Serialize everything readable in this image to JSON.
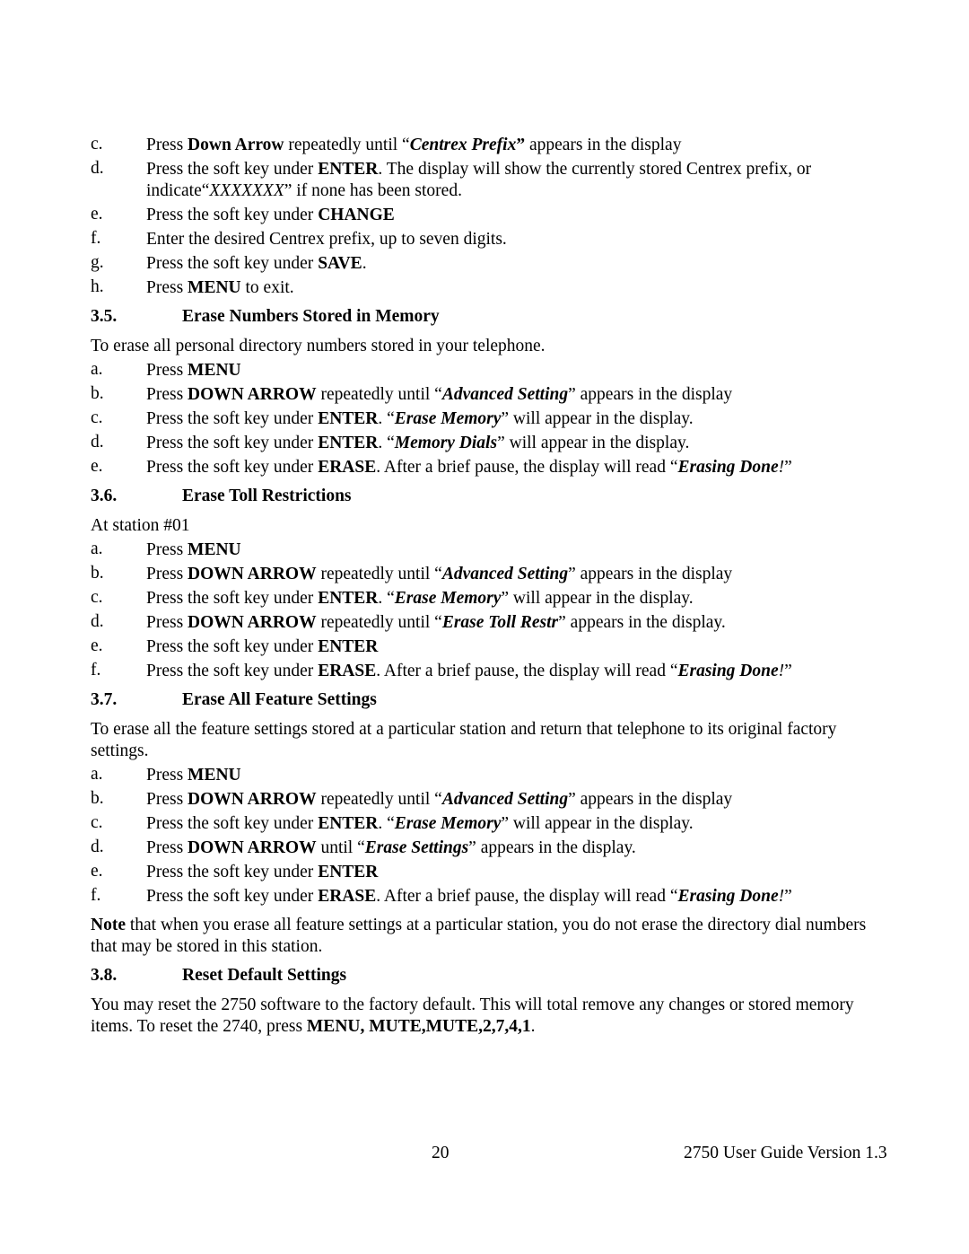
{
  "document": {
    "intro_steps": [
      {
        "letter": "c.",
        "runs": [
          [
            "",
            "Press "
          ],
          [
            "b",
            "Down Arrow"
          ],
          [
            "",
            " repeatedly until “"
          ],
          [
            "bi",
            "Centrex Prefix"
          ],
          [
            "b",
            "”"
          ],
          [
            "",
            " appears in the display"
          ]
        ]
      },
      {
        "letter": "d.",
        "runs": [
          [
            "",
            "Press the soft key under "
          ],
          [
            "b",
            "ENTER"
          ],
          [
            "",
            ". The display will show the currently stored Centrex prefix, or indicate“"
          ],
          [
            "i",
            "XXXXXXX"
          ],
          [
            "",
            "” if none has been stored."
          ]
        ]
      },
      {
        "letter": "e.",
        "runs": [
          [
            "",
            "Press the soft key under "
          ],
          [
            "b",
            "CHANGE"
          ]
        ]
      },
      {
        "letter": "f.",
        "runs": [
          [
            "",
            "Enter the desired Centrex prefix, up to seven digits."
          ]
        ]
      },
      {
        "letter": "g.",
        "runs": [
          [
            "",
            "Press the soft key under "
          ],
          [
            "b",
            "SAVE"
          ],
          [
            "",
            "."
          ]
        ]
      },
      {
        "letter": "h.",
        "runs": [
          [
            "",
            "Press "
          ],
          [
            "b",
            "MENU"
          ],
          [
            "",
            " to exit."
          ]
        ]
      }
    ],
    "sections": [
      {
        "number": "3.5.",
        "title": "Erase Numbers Stored in Memory",
        "intro": [
          [
            "",
            "To erase all personal directory numbers stored in your telephone."
          ]
        ],
        "steps": [
          {
            "letter": "a.",
            "runs": [
              [
                "",
                "Press "
              ],
              [
                "b",
                "MENU"
              ]
            ]
          },
          {
            "letter": "b.",
            "runs": [
              [
                "",
                "Press "
              ],
              [
                "b",
                "DOWN ARROW"
              ],
              [
                "",
                " repeatedly until “"
              ],
              [
                "bi",
                "Advanced Setting"
              ],
              [
                "",
                "” appears in the display"
              ]
            ]
          },
          {
            "letter": "c.",
            "runs": [
              [
                "",
                "Press the soft key under "
              ],
              [
                "b",
                "ENTER"
              ],
              [
                "",
                ". “"
              ],
              [
                "bi",
                "Erase Memory"
              ],
              [
                "",
                "” will appear in the display."
              ]
            ]
          },
          {
            "letter": "d.",
            "runs": [
              [
                "",
                "Press the soft key under "
              ],
              [
                "b",
                "ENTER"
              ],
              [
                "",
                ". “"
              ],
              [
                "bi",
                "Memory Dials"
              ],
              [
                "",
                "” will appear in the display."
              ]
            ]
          },
          {
            "letter": "e.",
            "runs": [
              [
                "",
                "Press the soft key under "
              ],
              [
                "b",
                "ERASE"
              ],
              [
                "",
                ". After a brief pause, the display will read “"
              ],
              [
                "bi",
                "Erasing Done"
              ],
              [
                "i",
                "!"
              ],
              [
                "",
                "”"
              ]
            ]
          }
        ]
      },
      {
        "number": "3.6.",
        "title": "Erase Toll Restrictions",
        "intro": [
          [
            "",
            "At station #01"
          ]
        ],
        "steps": [
          {
            "letter": "a.",
            "runs": [
              [
                "",
                "Press "
              ],
              [
                "b",
                "MENU"
              ]
            ]
          },
          {
            "letter": "b.",
            "runs": [
              [
                "",
                "Press "
              ],
              [
                "b",
                "DOWN ARROW"
              ],
              [
                "",
                " repeatedly until “"
              ],
              [
                "bi",
                "Advanced Setting"
              ],
              [
                "",
                "” appears in the display"
              ]
            ]
          },
          {
            "letter": "c.",
            "runs": [
              [
                "",
                "Press the soft key under "
              ],
              [
                "b",
                "ENTER"
              ],
              [
                "",
                ". “"
              ],
              [
                "bi",
                "Erase Memory"
              ],
              [
                "",
                "” will appear in the display."
              ]
            ]
          },
          {
            "letter": "d.",
            "runs": [
              [
                "",
                "Press "
              ],
              [
                "b",
                "DOWN ARROW"
              ],
              [
                "",
                " repeatedly until “"
              ],
              [
                "bi",
                "Erase Toll Restr"
              ],
              [
                "",
                "” appears in the display."
              ]
            ]
          },
          {
            "letter": "e.",
            "runs": [
              [
                "",
                "Press the soft key under "
              ],
              [
                "b",
                "ENTER"
              ]
            ]
          },
          {
            "letter": "f.",
            "runs": [
              [
                "",
                "Press the soft key under "
              ],
              [
                "b",
                "ERASE"
              ],
              [
                "",
                ". After a brief pause, the display will read “"
              ],
              [
                "bi",
                "Erasing Done"
              ],
              [
                "i",
                "!"
              ],
              [
                "",
                "”"
              ]
            ]
          }
        ]
      },
      {
        "number": "3.7.",
        "title": "Erase All Feature Settings",
        "intro": [
          [
            "",
            "To erase all the feature settings stored at a particular station and return that telephone to its original factory settings."
          ]
        ],
        "steps": [
          {
            "letter": "a.",
            "runs": [
              [
                "",
                "Press "
              ],
              [
                "b",
                "MENU"
              ]
            ]
          },
          {
            "letter": "b.",
            "runs": [
              [
                "",
                "Press "
              ],
              [
                "b",
                "DOWN ARROW"
              ],
              [
                "",
                " repeatedly until “"
              ],
              [
                "bi",
                "Advanced Setting"
              ],
              [
                "",
                "” appears in the display"
              ]
            ]
          },
          {
            "letter": "c.",
            "runs": [
              [
                "",
                "Press the soft key under "
              ],
              [
                "b",
                "ENTER"
              ],
              [
                "",
                ". “"
              ],
              [
                "bi",
                "Erase Memory"
              ],
              [
                "",
                "” will appear in the display."
              ]
            ]
          },
          {
            "letter": "d.",
            "runs": [
              [
                "",
                "Press "
              ],
              [
                "b",
                "DOWN ARROW"
              ],
              [
                "",
                " until “"
              ],
              [
                "bi",
                "Erase Settings"
              ],
              [
                "",
                "” appears in the display."
              ]
            ]
          },
          {
            "letter": "e.",
            "runs": [
              [
                "",
                "Press the soft key under "
              ],
              [
                "b",
                "ENTER"
              ]
            ]
          },
          {
            "letter": "f.",
            "runs": [
              [
                "",
                "Press the soft key under "
              ],
              [
                "b",
                "ERASE"
              ],
              [
                "",
                ". After a brief pause, the display will read “"
              ],
              [
                "bi",
                "Erasing Done"
              ],
              [
                "i",
                "!"
              ],
              [
                "",
                "”"
              ]
            ]
          }
        ],
        "note": [
          [
            "b",
            "Note"
          ],
          [
            "",
            " that when you erase all feature settings at a particular station, you do not erase the directory dial numbers that may be stored in this station."
          ]
        ]
      },
      {
        "number": "3.8.",
        "title": "Reset Default Settings",
        "intro": [
          [
            "",
            "You may reset the 2750 software to the factory default.  This will total remove any changes or stored memory items.  To reset the 2740, press "
          ],
          [
            "b",
            "MENU, MUTE,MUTE,2,7,4,1"
          ],
          [
            "",
            "."
          ]
        ],
        "steps": []
      }
    ]
  },
  "footer": {
    "page_number": "20",
    "guide_version": "2750 User Guide Version 1.3"
  }
}
